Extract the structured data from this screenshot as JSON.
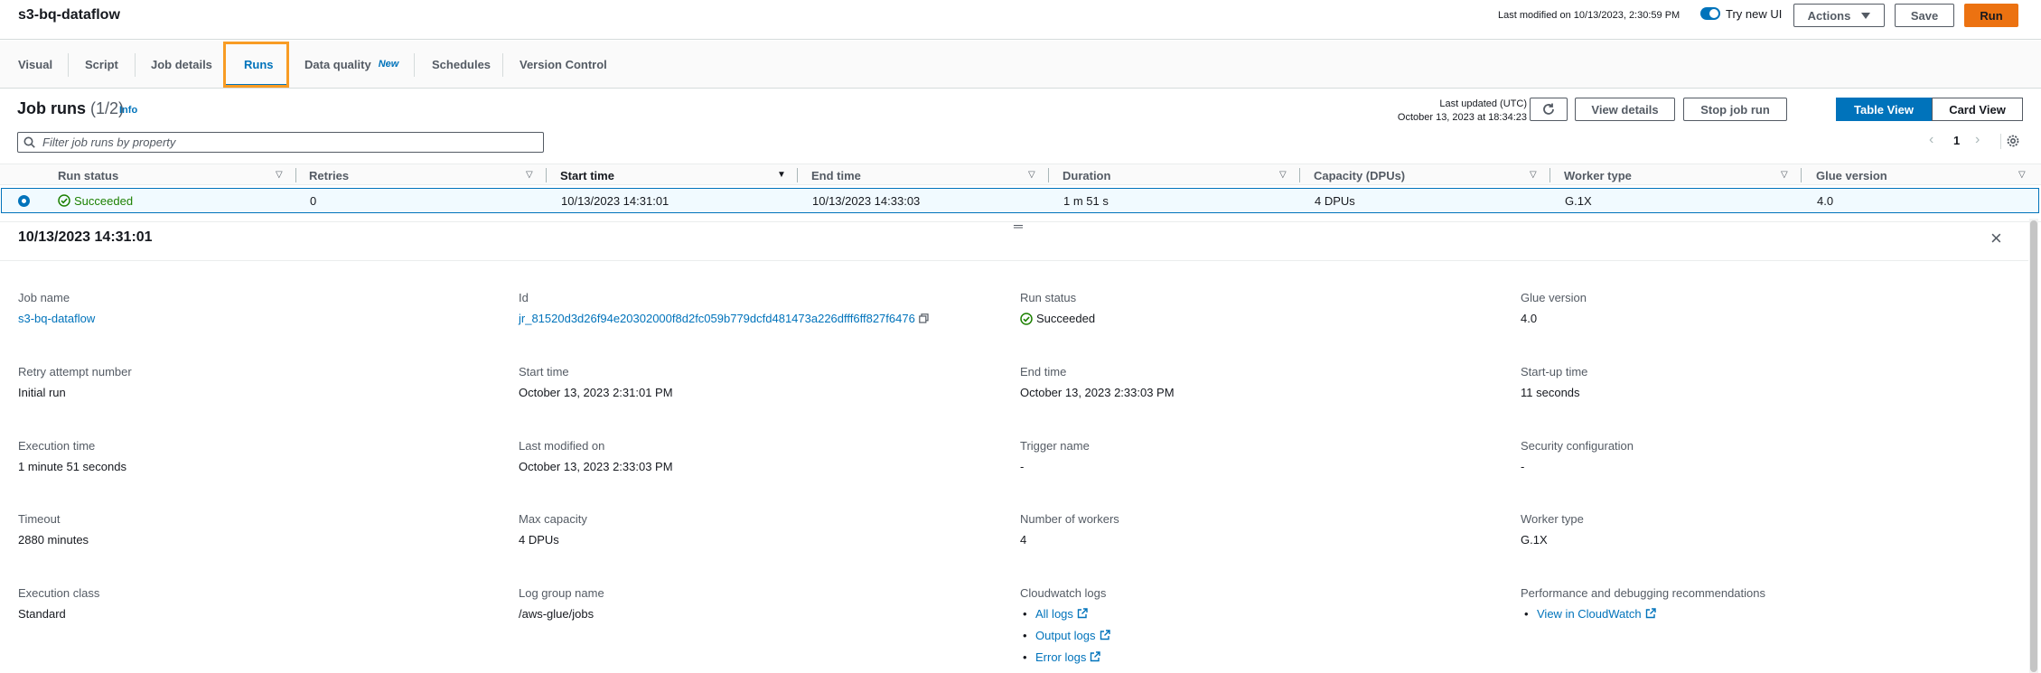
{
  "header": {
    "title": "s3-bq-dataflow",
    "last_modified": "Last modified on 10/13/2023, 2:30:59 PM",
    "toggle_label": "Try new UI",
    "actions_label": "Actions",
    "save_label": "Save",
    "run_label": "Run"
  },
  "tabs": [
    {
      "label": "Visual"
    },
    {
      "label": "Script"
    },
    {
      "label": "Job details"
    },
    {
      "label": "Runs"
    },
    {
      "label": "Data quality",
      "badge": "New"
    },
    {
      "label": "Schedules"
    },
    {
      "label": "Version Control"
    }
  ],
  "job_runs": {
    "title": "Job runs",
    "count": "(1/2)",
    "info": "Info",
    "last_updated_label": "Last updated (UTC)",
    "last_updated_value": "October 13, 2023 at 18:34:23",
    "view_details": "View details",
    "stop_job_run": "Stop job run",
    "table_view": "Table View",
    "card_view": "Card View",
    "filter_placeholder": "Filter job runs by property",
    "page": "1"
  },
  "table": {
    "columns": [
      "Run status",
      "Retries",
      "Start time",
      "End time",
      "Duration",
      "Capacity (DPUs)",
      "Worker type",
      "Glue version"
    ],
    "rows": [
      {
        "status": "Succeeded",
        "retries": "0",
        "start": "10/13/2023 14:31:01",
        "end": "10/13/2023 14:33:03",
        "duration": "1 m 51 s",
        "capacity": "4 DPUs",
        "worker": "G.1X",
        "glue": "4.0"
      }
    ]
  },
  "detail": {
    "title": "10/13/2023 14:31:01",
    "fields": {
      "job_name_label": "Job name",
      "job_name": "s3-bq-dataflow",
      "id_label": "Id",
      "id": "jr_81520d3d26f94e20302000f8d2fc059b779dcfd481473a226dfff6ff827f6476",
      "run_status_label": "Run status",
      "run_status": "Succeeded",
      "glue_version_label": "Glue version",
      "glue_version": "4.0",
      "retry_label": "Retry attempt number",
      "retry": "Initial run",
      "start_label": "Start time",
      "start": "October 13, 2023 2:31:01 PM",
      "end_label": "End time",
      "end": "October 13, 2023 2:33:03 PM",
      "startup_label": "Start-up time",
      "startup": "11 seconds",
      "exec_time_label": "Execution time",
      "exec_time": "1 minute 51 seconds",
      "last_mod_label": "Last modified on",
      "last_mod": "October 13, 2023 2:33:03 PM",
      "trigger_label": "Trigger name",
      "trigger": "-",
      "security_label": "Security configuration",
      "security": "-",
      "timeout_label": "Timeout",
      "timeout": "2880 minutes",
      "max_cap_label": "Max capacity",
      "max_cap": "4 DPUs",
      "workers_label": "Number of workers",
      "workers": "4",
      "worker_type_label": "Worker type",
      "worker_type": "G.1X",
      "exec_class_label": "Execution class",
      "exec_class": "Standard",
      "log_group_label": "Log group name",
      "log_group": "/aws-glue/jobs",
      "cw_logs_label": "Cloudwatch logs",
      "all_logs": "All logs",
      "output_logs": "Output logs",
      "error_logs": "Error logs",
      "perf_label": "Performance and debugging recommendations",
      "view_cw": "View in CloudWatch"
    }
  },
  "colors": {
    "accent": "#0073bb",
    "primary_button": "#ec7211",
    "success": "#1d8102",
    "highlight": "#f89c24"
  }
}
